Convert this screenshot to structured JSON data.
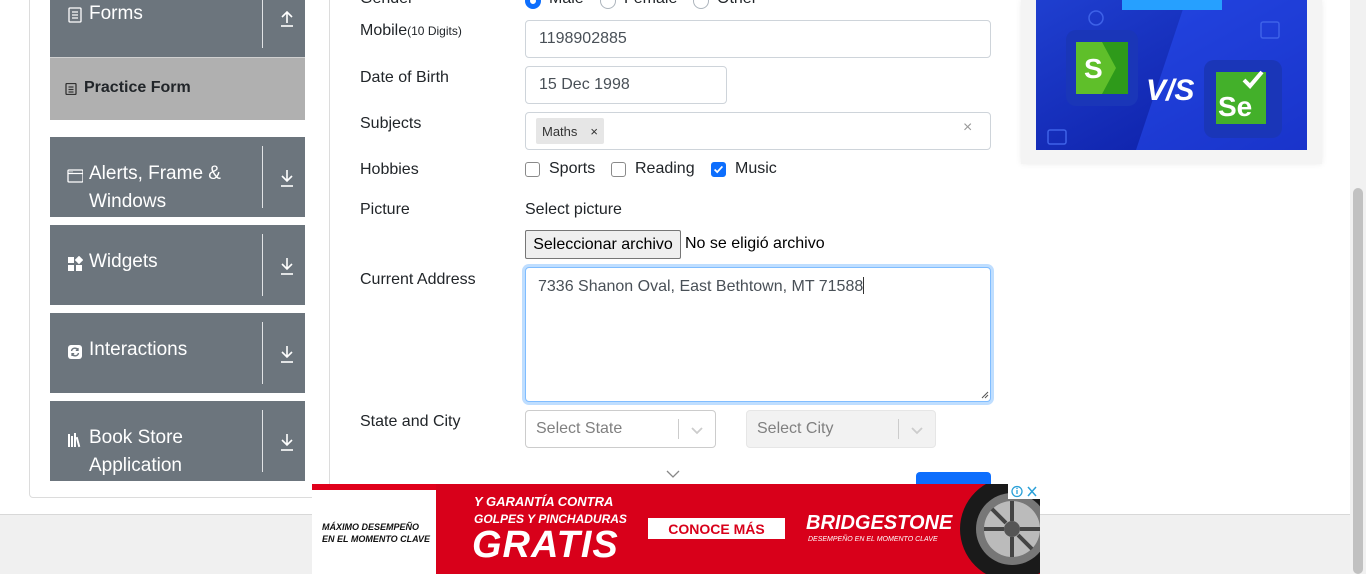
{
  "sidebar": {
    "groups": [
      {
        "label_lines": [
          "Forms"
        ]
      },
      {
        "label_lines": [
          "Alerts, Frame &",
          "Windows"
        ]
      },
      {
        "label_lines": [
          "Widgets"
        ]
      },
      {
        "label_lines": [
          "Interactions"
        ]
      },
      {
        "label_lines": [
          "Book Store",
          "Application"
        ]
      }
    ],
    "active_item": "Practice Form"
  },
  "form": {
    "gender": {
      "label": "Gender",
      "options": [
        "Male",
        "Female",
        "Other"
      ],
      "selected": "Male"
    },
    "mobile": {
      "label": "Mobile",
      "hint": "(10 Digits)",
      "value": "1198902885"
    },
    "dob": {
      "label": "Date of Birth",
      "value": "15 Dec 1998"
    },
    "subjects": {
      "label": "Subjects",
      "chips": [
        "Maths"
      ],
      "chip_remove": "×",
      "clear": "×"
    },
    "hobbies": {
      "label": "Hobbies",
      "options": [
        "Sports",
        "Reading",
        "Music"
      ],
      "checked": [
        "Music"
      ]
    },
    "picture": {
      "label": "Picture",
      "caption": "Select picture",
      "button": "Seleccionar archivo",
      "status": "No se eligió archivo"
    },
    "address": {
      "label": "Current Address",
      "value": "7336 Shanon Oval, East Bethtown, MT 71588"
    },
    "state_city": {
      "label": "State and City",
      "state_placeholder": "Select State",
      "city_placeholder": "Select City"
    }
  },
  "banner": {
    "left_tag_lines": [
      "MÁXIMO DESEMPEÑO",
      "EN EL MOMENTO CLAVE"
    ],
    "line1": "Y GARANTÍA CONTRA",
    "line2": "GOLPES Y PINCHADURAS",
    "headline": "GRATIS",
    "cta": "CONOCE MÁS",
    "brand": "BRIDGESTONE",
    "brand_tag": "DESEMPEÑO EN EL MOMENTO CLAVE"
  },
  "colors": {
    "sidebar_group": "#6c757d",
    "sidebar_active": "#b0b0b0",
    "accent": "#0d6efd",
    "banner_red": "#d8001a"
  }
}
